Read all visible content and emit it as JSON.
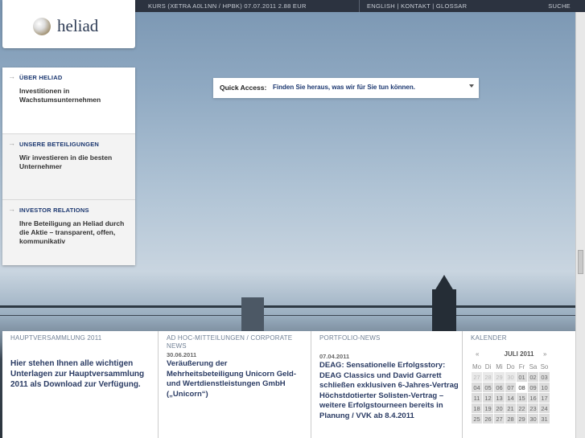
{
  "topbar": {
    "kurs": "KURS (XETRA A0L1NN / HPBK)   07.07.2011   2.88 EUR",
    "lang": [
      "ENGLISH",
      " | ",
      "KONTAKT",
      " | ",
      "GLOSSAR"
    ],
    "search": "SUCHE"
  },
  "logo": {
    "text": "heliad"
  },
  "nav": {
    "items": [
      {
        "title": "ÜBER HELIAD",
        "desc": "Investitionen in Wachstumsunternehmen"
      },
      {
        "title": "UNSERE BETEILIGUNGEN",
        "desc": "Wir investieren in die besten Unternehmer"
      },
      {
        "title": "INVESTOR RELATIONS",
        "desc": "Ihre Beteiligung an Heliad durch die Aktie – transparent, offen, kommunikativ"
      }
    ]
  },
  "quick_access": {
    "label": "Quick Access:",
    "value": "Finden Sie heraus, was wir für Sie tun können."
  },
  "columns": {
    "hv": {
      "head": "HAUPTVERSAMMLUNG 2011",
      "body": "Hier stehen Ihnen alle wichtigen Unterlagen zur Hauptversammlung 2011 als Download zur Verfügung."
    },
    "adhoc": {
      "head": "AD HOC-MITTEILUNGEN / CORPORATE NEWS",
      "date": "30.06.2011",
      "body": "Veräußerung der Mehrheitsbeteiligung Unicorn Geld- und Wertdienstleistungen GmbH („Unicorn“)"
    },
    "portfolio": {
      "head": "PORTFOLIO-NEWS",
      "date": "07.04.2011",
      "body": "DEAG: Sensationelle Erfolgsstory: DEAG Classics und David Garrett schließen exklusiven 6-Jahres-Vertrag Höchstdotierter Solisten-Vertrag – weitere Erfolgstourneen bereits in Planung / VVK ab 8.4.2011"
    },
    "calendar": {
      "head": "KALENDER",
      "prev": "«",
      "month": "JULI 2011",
      "next": "»",
      "weekdays": [
        "Mo",
        "Di",
        "Mi",
        "Do",
        "Fr",
        "Sa",
        "So"
      ],
      "weeks": [
        [
          "27",
          "28",
          "29",
          "30",
          "01",
          "02",
          "03"
        ],
        [
          "04",
          "05",
          "06",
          "07",
          "08",
          "09",
          "10"
        ],
        [
          "11",
          "12",
          "13",
          "14",
          "15",
          "16",
          "17"
        ],
        [
          "18",
          "19",
          "20",
          "21",
          "22",
          "23",
          "24"
        ],
        [
          "25",
          "26",
          "27",
          "28",
          "29",
          "30",
          "31"
        ]
      ],
      "outside_month_first_row": 4,
      "today": "08"
    }
  }
}
